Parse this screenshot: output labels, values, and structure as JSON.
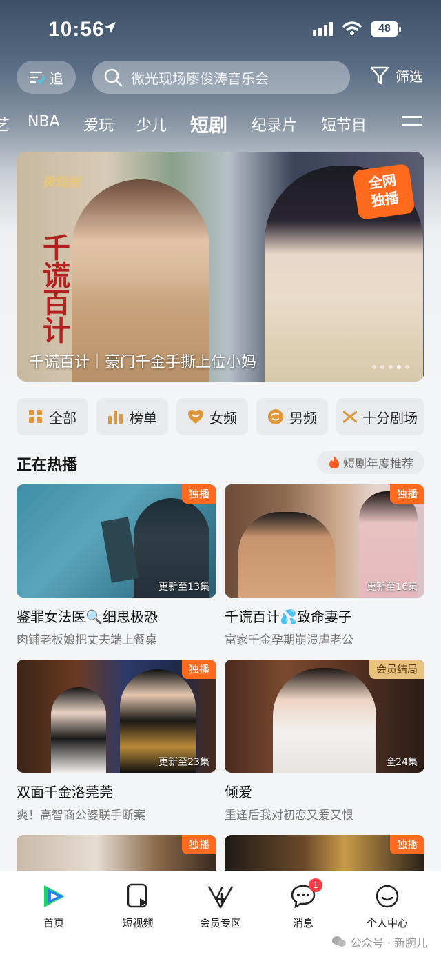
{
  "status_bar": {
    "time": "10:56",
    "battery": "48"
  },
  "header": {
    "follow_label": "追",
    "search_placeholder": "微光现场廖俊涛音乐会",
    "filter_label": "筛选"
  },
  "category_tabs": [
    {
      "label": "艺"
    },
    {
      "label": "NBA"
    },
    {
      "label": "爱玩"
    },
    {
      "label": "少儿"
    },
    {
      "label": "短剧",
      "active": true
    },
    {
      "label": "纪录片"
    },
    {
      "label": "短节目"
    }
  ],
  "banner": {
    "brand": "微短剧",
    "title_art": "千谎百计",
    "badge_line1": "全网",
    "badge_line2": "独播",
    "caption": "千谎百计｜豪门千金手撕上位小妈"
  },
  "quick_buttons": [
    {
      "label": "全部",
      "icon": "grid-icon",
      "color": "#e0973a"
    },
    {
      "label": "榜单",
      "icon": "bar-chart-icon",
      "color": "#e0973a"
    },
    {
      "label": "女频",
      "icon": "heart-icon",
      "color": "#e0973a"
    },
    {
      "label": "男频",
      "icon": "face-icon",
      "color": "#e0973a"
    },
    {
      "label": "十分剧场",
      "icon": "logo-icon",
      "color": "#e0973a"
    }
  ],
  "section": {
    "title": "正在热播",
    "recommend_label": "短剧年度推荐"
  },
  "cards": [
    {
      "tag": "独播",
      "episodes": "更新至13集",
      "title": "鉴罪女法医🔍细思极恐",
      "subtitle": "肉铺老板娘把丈夫端上餐桌"
    },
    {
      "tag": "独播",
      "episodes": "更新至16集",
      "title": "千谎百计💦致命妻子",
      "subtitle": "富家千金孕期崩溃虐老公"
    },
    {
      "tag": "独播",
      "episodes": "更新至23集",
      "title": "双面千金洛莞莞",
      "subtitle": "爽！高智商公婆联手断案"
    },
    {
      "tag": "会员结局",
      "episodes": "全24集",
      "title": "倾爱",
      "subtitle": "重逢后我对初恋又爱又恨"
    },
    {
      "tag": "独播",
      "episodes": "",
      "title": "",
      "subtitle": ""
    },
    {
      "tag": "独播",
      "episodes": "",
      "title": "",
      "subtitle": ""
    }
  ],
  "bottom_nav": [
    {
      "label": "首页",
      "icon": "home-play-icon"
    },
    {
      "label": "短视频",
      "icon": "short-video-icon"
    },
    {
      "label": "会员专区",
      "icon": "vip-icon"
    },
    {
      "label": "消息",
      "icon": "message-icon",
      "badge": "1"
    },
    {
      "label": "个人中心",
      "icon": "profile-icon"
    }
  ],
  "watermark": "公众号 · 新腕儿",
  "colors": {
    "accent": "#ff6a1f",
    "brand_green": "#1bd16b",
    "brand_blue": "#2a7cff"
  }
}
